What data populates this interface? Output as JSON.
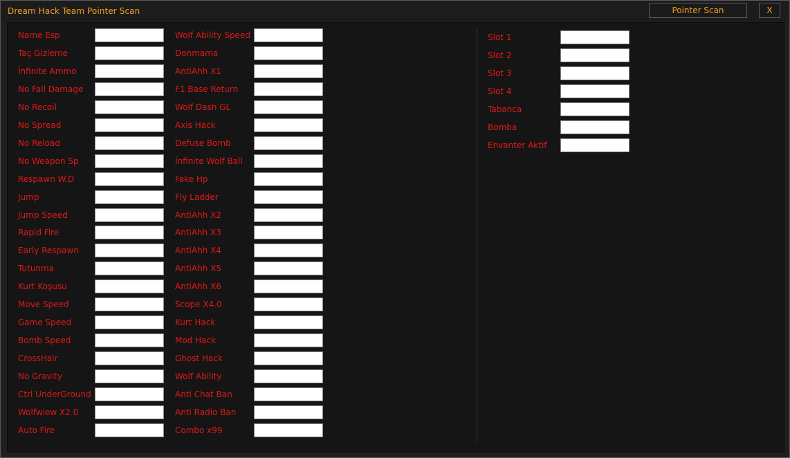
{
  "window": {
    "title": "Dream Hack Team Pointer Scan",
    "scan_button": "Pointer Scan",
    "close_button": "X"
  },
  "colors": {
    "label": "#e01818",
    "title": "#f0a020",
    "background": "#151515"
  },
  "col1": [
    {
      "label": "Name Esp",
      "value": ""
    },
    {
      "label": "Taç Gizleme",
      "value": ""
    },
    {
      "label": "İnfinite Ammo",
      "value": ""
    },
    {
      "label": "No Fall Damage",
      "value": ""
    },
    {
      "label": "No Recoil",
      "value": ""
    },
    {
      "label": "No Spread",
      "value": ""
    },
    {
      "label": "No Reload",
      "value": ""
    },
    {
      "label": "No Weapon Sp",
      "value": ""
    },
    {
      "label": "Respawn W.D",
      "value": ""
    },
    {
      "label": "Jump",
      "value": ""
    },
    {
      "label": "Jump Speed",
      "value": ""
    },
    {
      "label": "Rapid Fire",
      "value": ""
    },
    {
      "label": "Early Respawn",
      "value": ""
    },
    {
      "label": "Tutunma",
      "value": ""
    },
    {
      "label": "Kurt Koşusu",
      "value": ""
    },
    {
      "label": "Move Speed",
      "value": ""
    },
    {
      "label": "Game Speed",
      "value": ""
    },
    {
      "label": "Bomb Speed",
      "value": ""
    },
    {
      "label": "CrossHair",
      "value": ""
    },
    {
      "label": "No Gravity",
      "value": ""
    },
    {
      "label": "Ctrl UnderGround",
      "value": ""
    },
    {
      "label": "Wolfwiew X2.0",
      "value": ""
    },
    {
      "label": "Auto Fire",
      "value": ""
    }
  ],
  "col2": [
    {
      "label": "Wolf Ability Speed",
      "value": ""
    },
    {
      "label": "Donmama",
      "value": ""
    },
    {
      "label": "AntiAhh X1",
      "value": ""
    },
    {
      "label": "F1 Base Return",
      "value": ""
    },
    {
      "label": "Wolf Dash GL",
      "value": ""
    },
    {
      "label": "Axis Hack",
      "value": ""
    },
    {
      "label": "Defuse Bomb",
      "value": ""
    },
    {
      "label": "İnfinite Wolf Ball",
      "value": ""
    },
    {
      "label": "Fake Hp",
      "value": ""
    },
    {
      "label": "Fly Ladder",
      "value": ""
    },
    {
      "label": "AntiAhh X2",
      "value": ""
    },
    {
      "label": "AntiAhh X3",
      "value": ""
    },
    {
      "label": "AntiAhh X4",
      "value": ""
    },
    {
      "label": "AntiAhh X5",
      "value": ""
    },
    {
      "label": "AntiAhh X6",
      "value": ""
    },
    {
      "label": "Scope X4.0",
      "value": ""
    },
    {
      "label": "Kurt Hack",
      "value": ""
    },
    {
      "label": "Mod Hack",
      "value": ""
    },
    {
      "label": "Ghost Hack",
      "value": ""
    },
    {
      "label": "Wolf Ability",
      "value": ""
    },
    {
      "label": "Anti Chat Ban",
      "value": ""
    },
    {
      "label": "Anti Radio Ban",
      "value": ""
    },
    {
      "label": "Combo x99",
      "value": ""
    }
  ],
  "col3": [
    {
      "label": "Slot 1",
      "value": ""
    },
    {
      "label": "Slot 2",
      "value": ""
    },
    {
      "label": "Slot 3",
      "value": ""
    },
    {
      "label": "Slot 4",
      "value": ""
    },
    {
      "label": "Tabanca",
      "value": ""
    },
    {
      "label": "Bomba",
      "value": ""
    },
    {
      "label": "Envanter Aktif",
      "value": ""
    }
  ]
}
